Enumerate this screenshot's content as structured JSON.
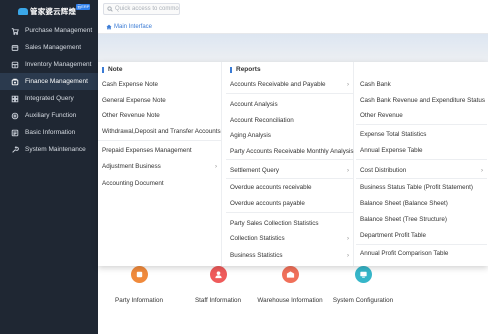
{
  "logo": {
    "text": "管家婆云辉煌",
    "badge": "云ERP"
  },
  "sidebar": {
    "items": [
      {
        "label": "Purchase Management",
        "icon": "cart-icon"
      },
      {
        "label": "Sales Management",
        "icon": "sales-icon"
      },
      {
        "label": "Inventory Management",
        "icon": "inventory-icon"
      },
      {
        "label": "Finance Management",
        "icon": "finance-icon"
      },
      {
        "label": "Integrated Query",
        "icon": "query-icon"
      },
      {
        "label": "Auxiliary Function",
        "icon": "auxiliary-icon"
      },
      {
        "label": "Basic Information",
        "icon": "info-icon"
      },
      {
        "label": "System Maintenance",
        "icon": "maintenance-icon"
      }
    ],
    "active": "Finance Management"
  },
  "search": {
    "placeholder": "Quick access to commo"
  },
  "tabs": [
    {
      "label": "Main Interface",
      "icon": "home-icon"
    }
  ],
  "menu": {
    "note": {
      "heading": "Note",
      "items": [
        "Cash Expense Note",
        "General Expense Note",
        "Other Revenue Note",
        "Withdrawal,Deposit and Transfer Accounts",
        "Prepaid Expenses Management",
        "Adjustment Business",
        "Accounting Document"
      ]
    },
    "reports": {
      "heading": "Reports",
      "items": [
        "Accounts Receivable and Payable",
        "Account Analysis",
        "Account Reconciliation",
        "Aging Analysis",
        "Party Accounts Receivable Monthly Analysis",
        "Settlement Query",
        "Overdue accounts receivable",
        "Overdue accounts payable",
        "Party Sales Collection Statistics",
        "Collection Statistics",
        "Business Statistics"
      ]
    },
    "reports2": {
      "items": [
        "Cash Bank",
        "Cash Bank Revenue and Expenditure Status",
        "Other Revenue",
        "Expense Total Statistics",
        "Annual Expense Table",
        "Cost Distribution",
        "Business Status Table (Profit Statement)",
        "Balance Sheet (Balance Sheet)",
        "Balance Sheet (Tree Structure)",
        "Department Profit Table",
        "Annual Profit Comparison Table"
      ]
    },
    "arrow": "›"
  },
  "config": [
    {
      "label": "Party Information",
      "color": "#f08a3c",
      "icon": "party-icon"
    },
    {
      "label": "Staff Information",
      "color": "#ef5b5b",
      "icon": "staff-icon"
    },
    {
      "label": "Warehouse Information",
      "color": "#f0705a",
      "icon": "warehouse-icon"
    },
    {
      "label": "System Configuration",
      "color": "#36b6c9",
      "icon": "system-config-icon"
    }
  ]
}
